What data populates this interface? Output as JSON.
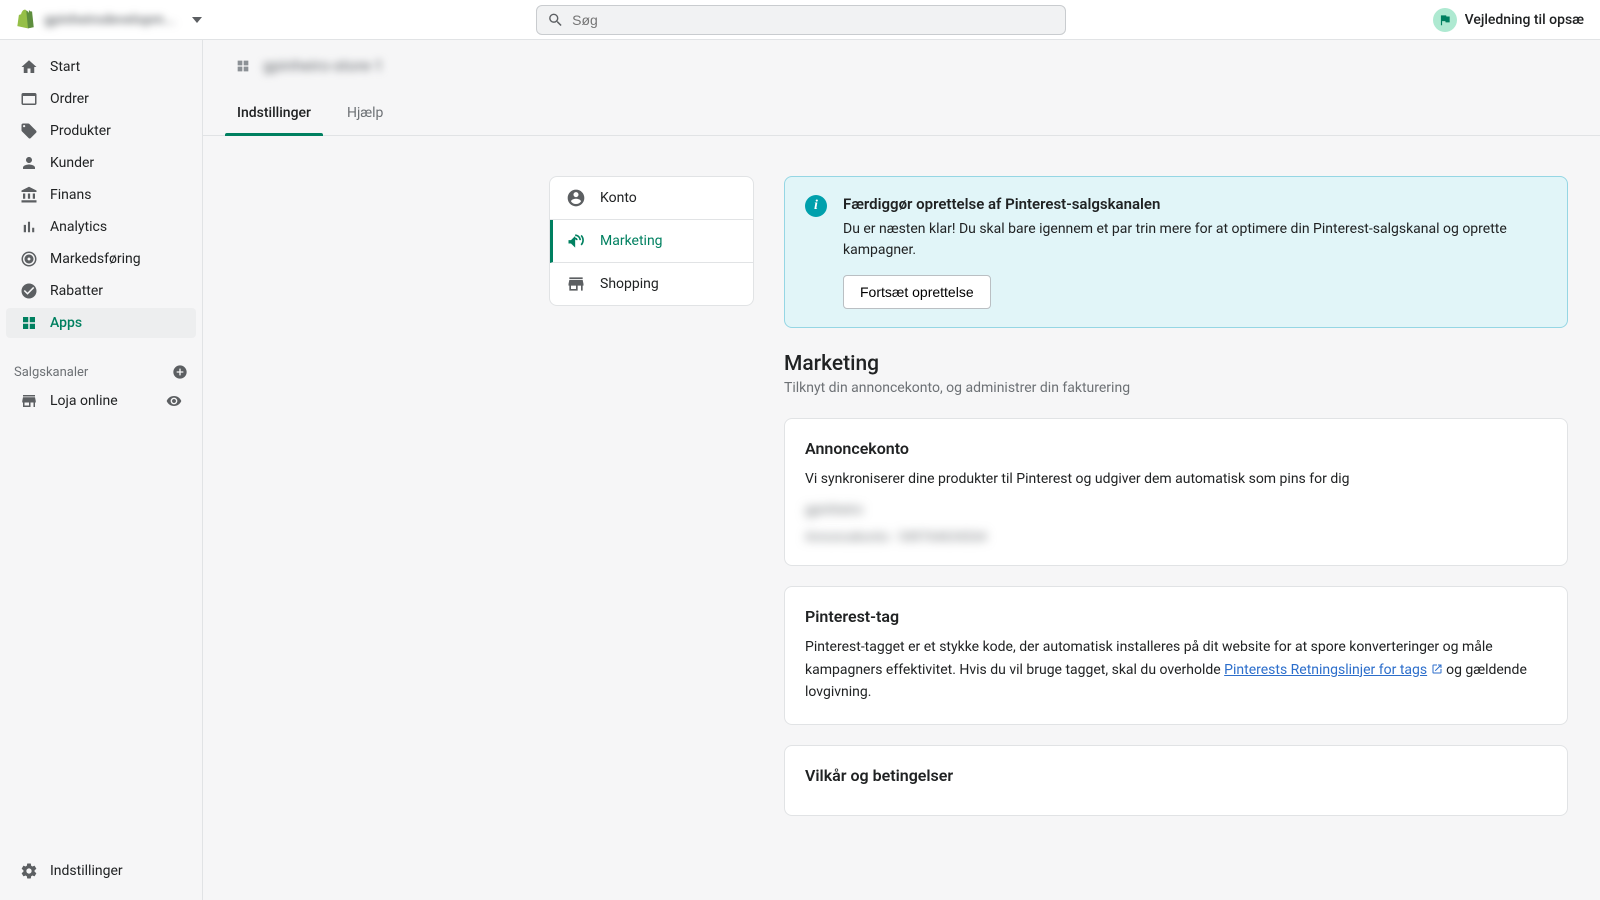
{
  "header": {
    "store_name": "gpinheirodevelopm...",
    "search_placeholder": "Søg",
    "guide_label": "Vejledning til opsæ"
  },
  "sidebar": {
    "items": [
      {
        "label": "Start"
      },
      {
        "label": "Ordrer"
      },
      {
        "label": "Produkter"
      },
      {
        "label": "Kunder"
      },
      {
        "label": "Finans"
      },
      {
        "label": "Analytics"
      },
      {
        "label": "Markedsføring"
      },
      {
        "label": "Rabatter"
      },
      {
        "label": "Apps"
      }
    ],
    "channels_label": "Salgskanaler",
    "online_store": "Loja online",
    "settings": "Indstillinger"
  },
  "breadcrumb": "gpinheiro-store-1",
  "tabs": [
    {
      "label": "Indstillinger",
      "active": true
    },
    {
      "label": "Hjælp",
      "active": false
    }
  ],
  "subnav": [
    {
      "label": "Konto"
    },
    {
      "label": "Marketing"
    },
    {
      "label": "Shopping"
    }
  ],
  "banner": {
    "title": "Færdiggør oprettelse af Pinterest-salgskanalen",
    "body": "Du er næsten klar! Du skal bare igennem et par trin mere for at optimere din Pinterest-salgskanal og oprette kampagner.",
    "button": "Fortsæt oprettelse"
  },
  "marketing": {
    "title": "Marketing",
    "subtitle": "Tilknyt din annoncekonto, og administrer din fakturering"
  },
  "ad_account": {
    "title": "Annoncekonto",
    "desc": "Vi synkroniserer dine produkter til Pinterest og udgiver dem automatisk som pins for dig",
    "blur1": "gpinheiro",
    "blur2": "Annoncekonto - 549764634264"
  },
  "tag": {
    "title": "Pinterest-tag",
    "desc_a": "Pinterest-tagget er et stykke kode, der automatisk installeres på dit website for at spore konverteringer og måle kampagners effektivitet. Hvis du vil bruge tagget, skal du overholde ",
    "link": "Pinterests Retningslinjer for tags",
    "desc_b": " og gældende lovgivning."
  },
  "terms": {
    "title": "Vilkår og betingelser"
  }
}
